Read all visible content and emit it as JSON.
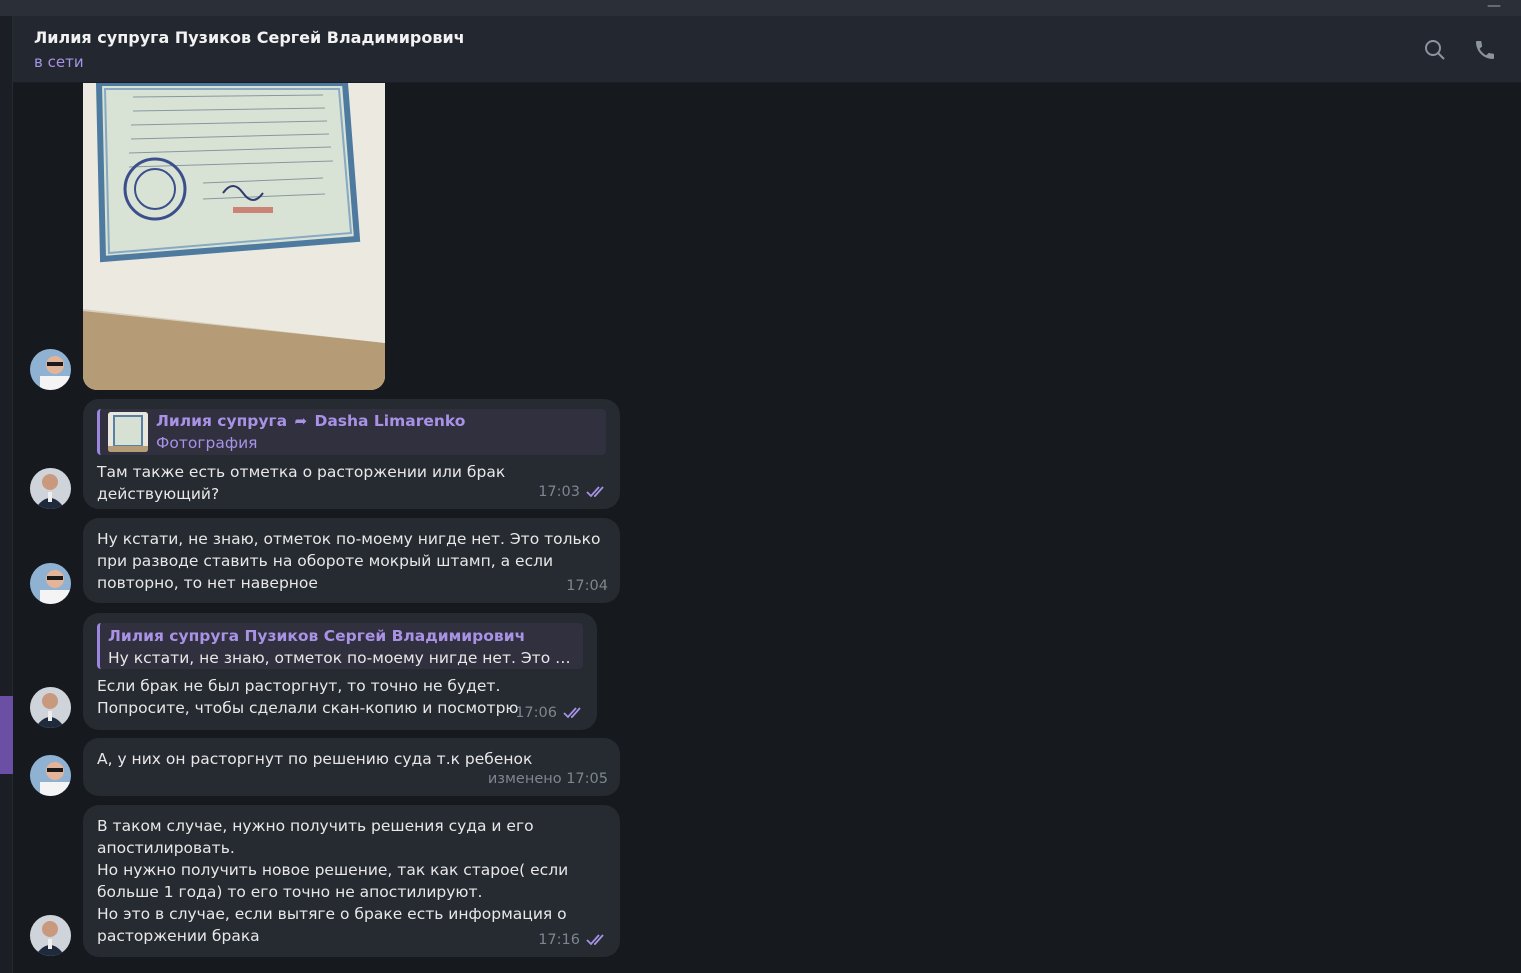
{
  "chat": {
    "title": "Лилия супруга Пузиков Сергей Владимирович",
    "status": "в сети"
  },
  "icons": {
    "search": "search-icon",
    "call": "phone-icon",
    "read": "double-check-icon",
    "forward": "forward-arrow-icon"
  },
  "colors": {
    "accent": "#a792e6",
    "bubble": "#262a31",
    "background": "#16191e",
    "header": "#232830"
  },
  "messages": [
    {
      "quote_author": "Лилия супруга",
      "quote_forwarded_from": "Dasha Limarenko",
      "quote_sub": "Фотография",
      "text": "Там также есть отметка о расторжении или брак действующий?",
      "time": "17:03"
    },
    {
      "text": "Ну кстати, не знаю, отметок по-моему нигде нет. Это только при разводе ставить на обороте мокрый штамп, а если повторно, то нет наверное",
      "time": "17:04"
    },
    {
      "quote_author": "Лилия супруга Пузиков Сергей Владимирович",
      "quote_text": "Ну кстати, не знаю, отметок по-моему нигде нет. Это тольк...",
      "text": "Если брак не был расторгнут, то точно не будет.\nПопросите, чтобы сделали скан-копию и посмотрю",
      "time": "17:06"
    },
    {
      "text": "А, у них он расторгнут по решению суда т.к ребенок",
      "time": "изменено 17:05"
    },
    {
      "text": "В таком случае, нужно получить решения суда и его апостилировать.\nНо нужно получить новое решение, так как старое( если больше 1 года) то его точно не апостилируют.\nНо это в случае, если вытяге о браке есть информация о расторжении брака",
      "time": "17:16"
    }
  ]
}
